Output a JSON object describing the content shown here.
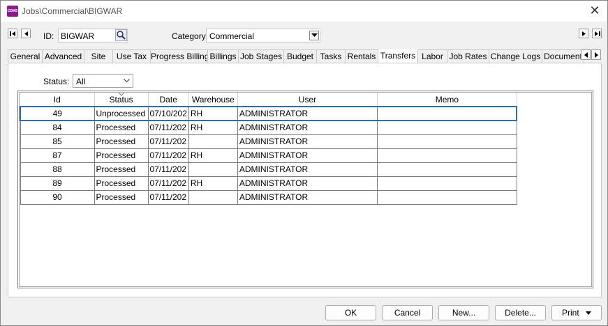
{
  "window": {
    "title": "Jobs\\Commercial\\BIGWAR",
    "app_icon_text": "CDMS"
  },
  "header": {
    "id_label": "ID:",
    "id_value": "BIGWAR",
    "category_label": "Category:",
    "category_value": "Commercial"
  },
  "tabs": [
    {
      "label": "General"
    },
    {
      "label": "Advanced"
    },
    {
      "label": "Site"
    },
    {
      "label": "Use Tax"
    },
    {
      "label": "Progress Billing"
    },
    {
      "label": "Billings"
    },
    {
      "label": "Job Stages"
    },
    {
      "label": "Budget"
    },
    {
      "label": "Tasks"
    },
    {
      "label": "Rentals"
    },
    {
      "label": "Transfers",
      "active": true
    },
    {
      "label": "Labor"
    },
    {
      "label": "Job Rates"
    },
    {
      "label": "Change Logs"
    },
    {
      "label": "Document"
    }
  ],
  "filter": {
    "status_label": "Status:",
    "status_value": "All"
  },
  "grid": {
    "columns": [
      "Id",
      "Status",
      "Date",
      "Warehouse",
      "User",
      "Memo"
    ],
    "rows": [
      {
        "id": "49",
        "status": "Unprocessed",
        "date": "07/10/202",
        "warehouse": "RH",
        "user": "ADMINISTRATOR",
        "memo": "",
        "selected": true
      },
      {
        "id": "84",
        "status": "Processed",
        "date": "07/11/202",
        "warehouse": "RH",
        "user": "ADMINISTRATOR",
        "memo": ""
      },
      {
        "id": "85",
        "status": "Processed",
        "date": "07/11/202",
        "warehouse": "",
        "user": "ADMINISTRATOR",
        "memo": ""
      },
      {
        "id": "87",
        "status": "Processed",
        "date": "07/11/202",
        "warehouse": "RH",
        "user": "ADMINISTRATOR",
        "memo": ""
      },
      {
        "id": "88",
        "status": "Processed",
        "date": "07/11/202",
        "warehouse": "",
        "user": "ADMINISTRATOR",
        "memo": ""
      },
      {
        "id": "89",
        "status": "Processed",
        "date": "07/11/202",
        "warehouse": "RH",
        "user": "ADMINISTRATOR",
        "memo": ""
      },
      {
        "id": "90",
        "status": "Processed",
        "date": "07/11/202",
        "warehouse": "",
        "user": "ADMINISTRATOR",
        "memo": ""
      }
    ]
  },
  "buttons": {
    "ok": "OK",
    "cancel": "Cancel",
    "new": "New...",
    "delete": "Delete...",
    "print": "Print"
  },
  "colors": {
    "selection_border": "#2a6db5",
    "app_icon": "#8b1a8f"
  }
}
